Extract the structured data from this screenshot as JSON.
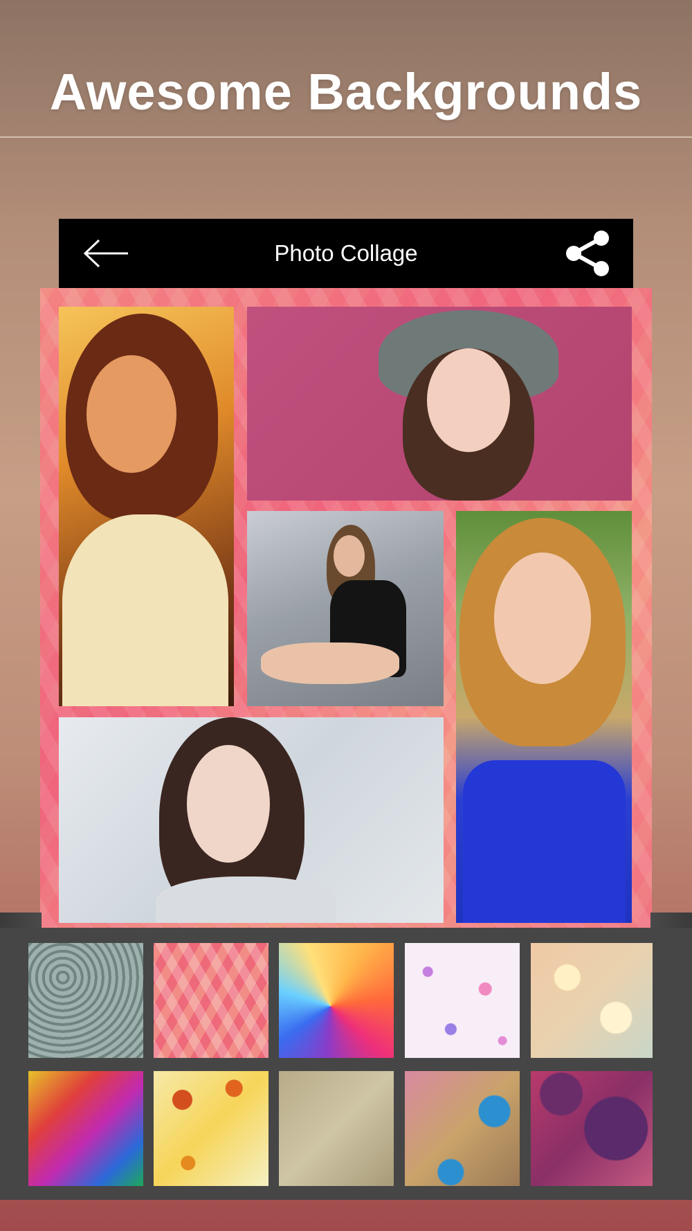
{
  "hero": {
    "title": "Awesome Backgrounds"
  },
  "appbar": {
    "title": "Photo Collage",
    "back_icon": "arrow-left-icon",
    "share_icon": "share-icon"
  },
  "collage": {
    "photos": [
      {
        "id": "photo-1",
        "description_icon": "portrait-photo"
      },
      {
        "id": "photo-2",
        "description_icon": "portrait-photo"
      },
      {
        "id": "photo-3",
        "description_icon": "portrait-photo"
      },
      {
        "id": "photo-4",
        "description_icon": "portrait-photo"
      },
      {
        "id": "photo-5",
        "description_icon": "portrait-photo"
      }
    ]
  },
  "backgrounds": {
    "count": 10
  },
  "colors": {
    "appbar": "#000000",
    "tray": "#464646",
    "hero_text": "#ffffff"
  }
}
